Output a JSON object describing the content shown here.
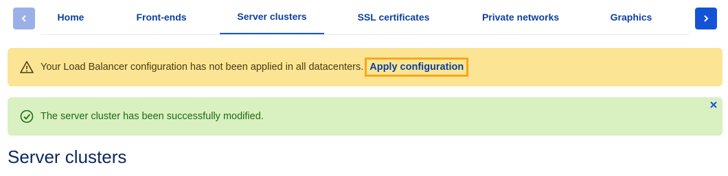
{
  "tabs_nav": {
    "prev_icon": "chevron-left-icon",
    "next_icon": "chevron-right-icon",
    "tabs": [
      {
        "label": "Home",
        "active": false
      },
      {
        "label": "Front-ends",
        "active": false
      },
      {
        "label": "Server clusters",
        "active": true
      },
      {
        "label": "SSL certificates",
        "active": false
      },
      {
        "label": "Private networks",
        "active": false
      },
      {
        "label": "Graphics",
        "active": false
      }
    ]
  },
  "warning_alert": {
    "icon": "warning-triangle-icon",
    "message": "Your Load Balancer configuration has not been applied in all datacenters.",
    "link_label": "Apply configuration"
  },
  "success_alert": {
    "icon": "check-circle-icon",
    "message": "The server cluster has been successfully modified.",
    "close_icon": "close-icon"
  },
  "page": {
    "title": "Server clusters"
  },
  "colors": {
    "accent": "#1553d6",
    "warning_bg": "#fbe594",
    "success_bg": "#d9f0c1",
    "highlight": "#f9a51a"
  }
}
